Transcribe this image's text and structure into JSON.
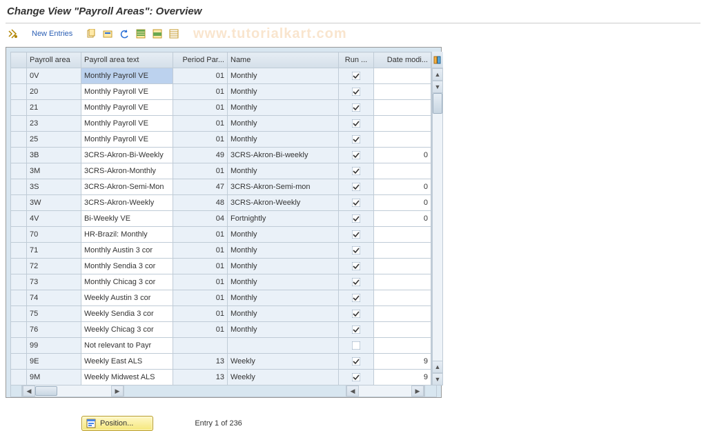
{
  "title": "Change View \"Payroll Areas\": Overview",
  "watermark": "www.tutorialkart.com",
  "toolbar": {
    "new_entries": "New Entries"
  },
  "columns": {
    "area": "Payroll area",
    "text": "Payroll area text",
    "period": "Period Par...",
    "name": "Name",
    "run": "Run ...",
    "date": "Date modi..."
  },
  "rows": [
    {
      "area": "0V",
      "text": "Monthly Payroll  VE",
      "period": "01",
      "name": "Monthly",
      "run": true,
      "date": "",
      "highlight_text": true
    },
    {
      "area": "20",
      "text": "Monthly Payroll  VE",
      "period": "01",
      "name": "Monthly",
      "run": true,
      "date": ""
    },
    {
      "area": "21",
      "text": "Monthly Payroll  VE",
      "period": "01",
      "name": "Monthly",
      "run": true,
      "date": ""
    },
    {
      "area": "23",
      "text": "Monthly Payroll  VE",
      "period": "01",
      "name": "Monthly",
      "run": true,
      "date": ""
    },
    {
      "area": "25",
      "text": "Monthly Payroll  VE",
      "period": "01",
      "name": "Monthly",
      "run": true,
      "date": ""
    },
    {
      "area": "3B",
      "text": "3CRS-Akron-Bi-Weekly",
      "period": "49",
      "name": "3CRS-Akron-Bi-weekly",
      "run": true,
      "date": "0"
    },
    {
      "area": "3M",
      "text": "3CRS-Akron-Monthly",
      "period": "01",
      "name": "Monthly",
      "run": true,
      "date": ""
    },
    {
      "area": "3S",
      "text": "3CRS-Akron-Semi-Mon",
      "period": "47",
      "name": "3CRS-Akron-Semi-mon",
      "run": true,
      "date": "0"
    },
    {
      "area": "3W",
      "text": "3CRS-Akron-Weekly",
      "period": "48",
      "name": "3CRS-Akron-Weekly",
      "run": true,
      "date": "0"
    },
    {
      "area": "4V",
      "text": "Bi-Weekly VE",
      "period": "04",
      "name": "Fortnightly",
      "run": true,
      "date": "0"
    },
    {
      "area": "70",
      "text": "HR-Brazil: Monthly",
      "period": "01",
      "name": "Monthly",
      "run": true,
      "date": ""
    },
    {
      "area": "71",
      "text": "Monthly Austin 3 cor",
      "period": "01",
      "name": "Monthly",
      "run": true,
      "date": ""
    },
    {
      "area": "72",
      "text": "Monthly Sendia 3 cor",
      "period": "01",
      "name": "Monthly",
      "run": true,
      "date": ""
    },
    {
      "area": "73",
      "text": "Monthly Chicag 3 cor",
      "period": "01",
      "name": "Monthly",
      "run": true,
      "date": ""
    },
    {
      "area": "74",
      "text": "Weekly Austin 3 cor",
      "period": "01",
      "name": "Monthly",
      "run": true,
      "date": ""
    },
    {
      "area": "75",
      "text": "Weekly Sendia 3 cor",
      "period": "01",
      "name": "Monthly",
      "run": true,
      "date": ""
    },
    {
      "area": "76",
      "text": "Weekly Chicag 3 cor",
      "period": "01",
      "name": "Monthly",
      "run": true,
      "date": ""
    },
    {
      "area": "99",
      "text": "Not relevant to Payr",
      "period": "",
      "name": "",
      "run": false,
      "date": ""
    },
    {
      "area": "9E",
      "text": "Weekly East ALS",
      "period": "13",
      "name": "Weekly",
      "run": true,
      "date": "9"
    },
    {
      "area": "9M",
      "text": "Weekly Midwest ALS",
      "period": "13",
      "name": "Weekly",
      "run": true,
      "date": "9"
    }
  ],
  "footer": {
    "position_btn": "Position...",
    "entry_label": "Entry 1 of 236"
  }
}
